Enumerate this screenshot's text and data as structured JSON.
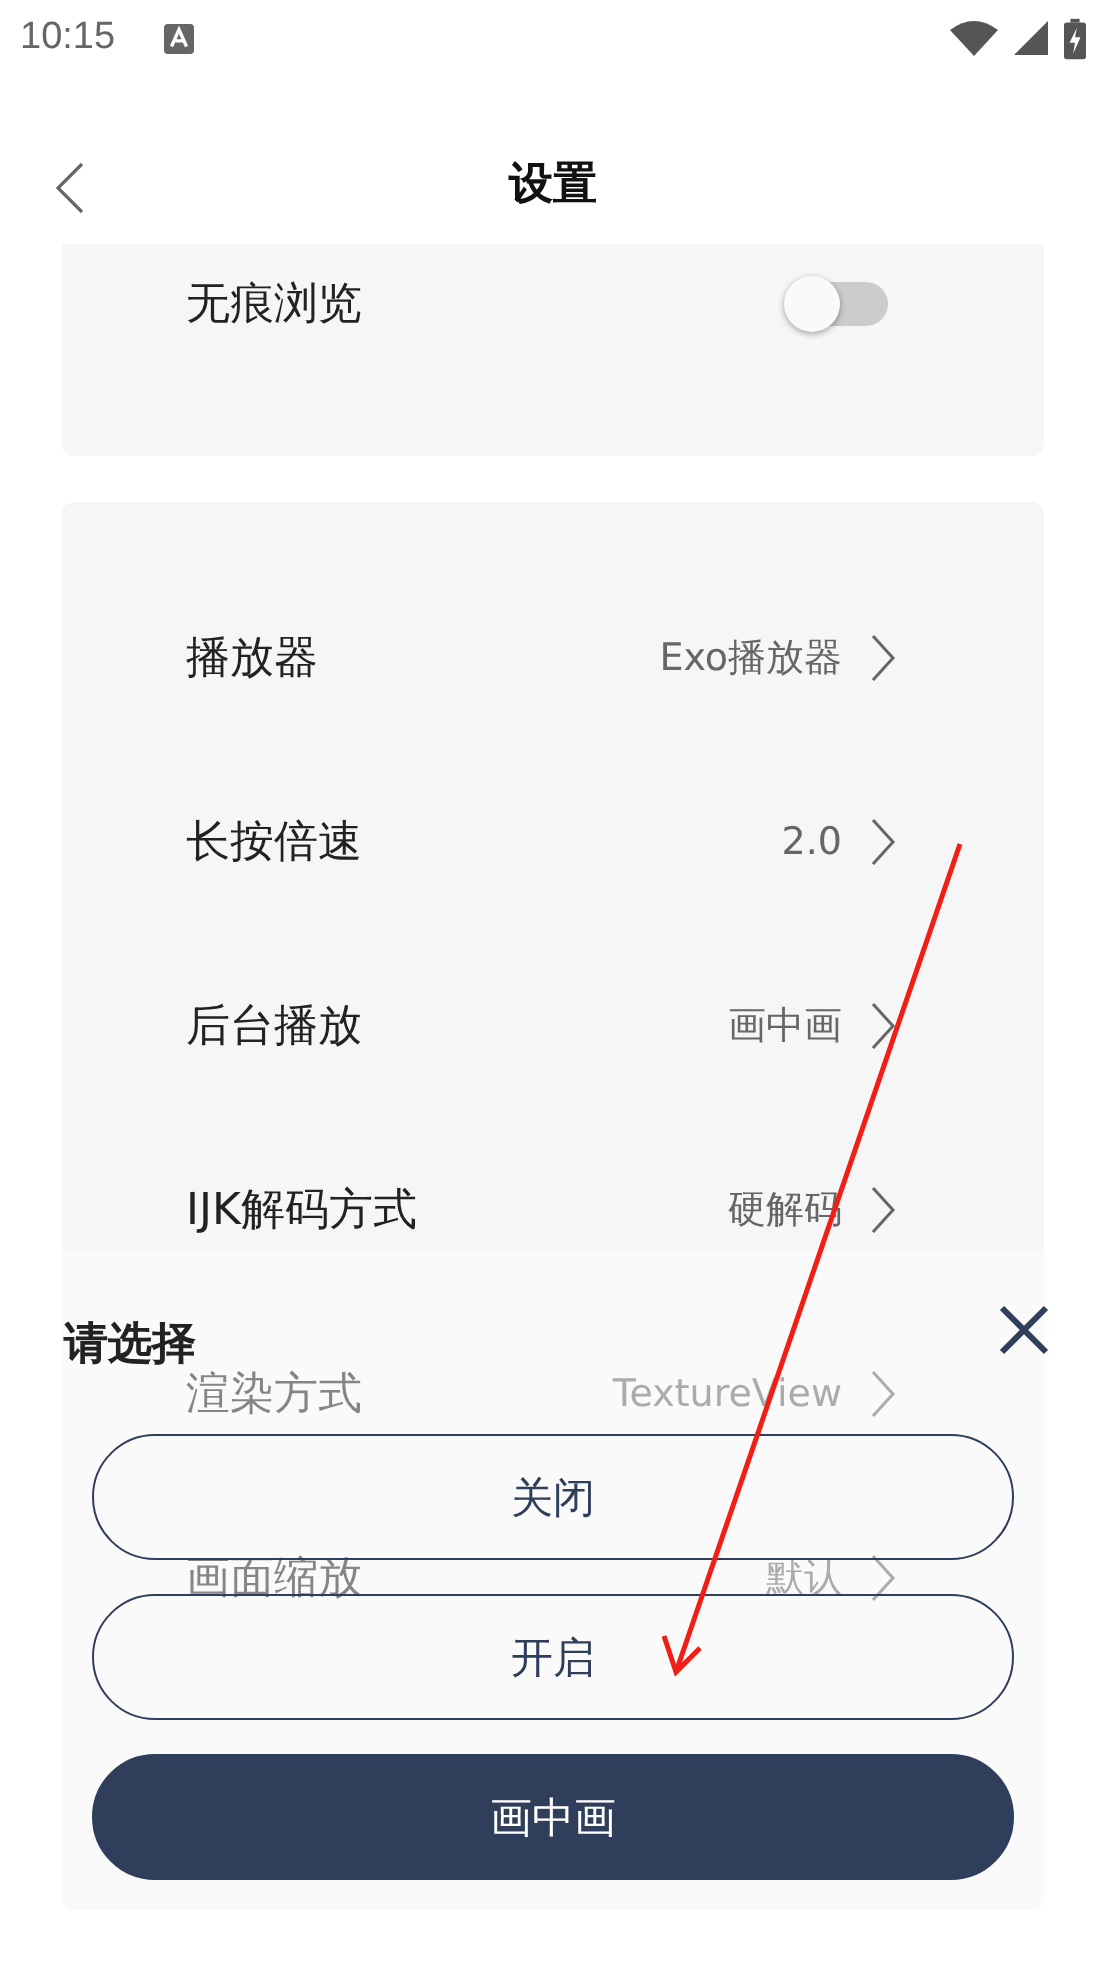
{
  "status_bar": {
    "time": "10:15"
  },
  "header": {
    "title": "设置"
  },
  "sections": [
    {
      "rows": [
        {
          "kind": "toggle",
          "label": "无痕浏览",
          "on": false
        }
      ]
    },
    {
      "rows": [
        {
          "kind": "value",
          "label": "播放器",
          "value": "Exo播放器"
        },
        {
          "kind": "value",
          "label": "长按倍速",
          "value": "2.0"
        },
        {
          "kind": "value",
          "label": "后台播放",
          "value": "画中画"
        },
        {
          "kind": "value",
          "label": "IJK解码方式",
          "value": "硬解码"
        },
        {
          "kind": "value",
          "label": "渲染方式",
          "value": "TextureView"
        },
        {
          "kind": "value",
          "label": "画面缩放",
          "value": "默认"
        }
      ]
    }
  ],
  "sheet": {
    "title": "请选择",
    "options": [
      {
        "label": "关闭",
        "selected": false
      },
      {
        "label": "开启",
        "selected": false
      },
      {
        "label": "画中画",
        "selected": true
      }
    ]
  }
}
